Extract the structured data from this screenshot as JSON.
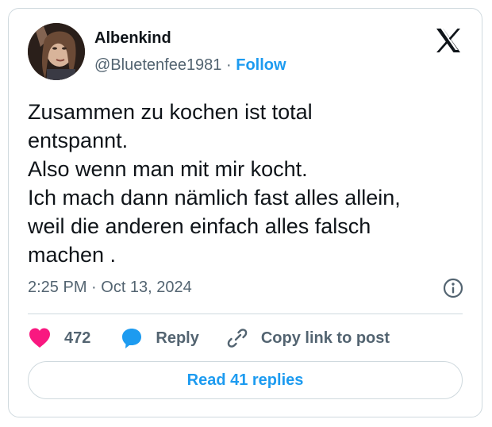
{
  "tweet": {
    "author": {
      "display_name": "Albenkind",
      "handle": "@Bluetenfee1981",
      "separator": "·",
      "follow_label": "Follow",
      "avatar_icon": "user-avatar-photo"
    },
    "brand_icon": "x-logo-icon",
    "text": "Zusammen zu kochen ist total\nentspannt.\nAlso wenn man mit mir kocht.\nIch mach dann nämlich fast alles allein,\nweil die anderen einfach alles falsch\nmachen .",
    "timestamp": "2:25 PM · Oct 13, 2024",
    "info_icon": "info-icon",
    "actions": {
      "like_count": "472",
      "like_icon": "heart-icon",
      "reply_label": "Reply",
      "reply_icon": "speech-bubble-icon",
      "copy_label": "Copy link to post",
      "copy_icon": "link-icon"
    },
    "read_replies_label": "Read 41 replies"
  },
  "colors": {
    "accent": "#1d9bf0",
    "like": "#f91880",
    "text": "#0f1419",
    "secondary": "#536471",
    "border": "#cfd9de"
  }
}
